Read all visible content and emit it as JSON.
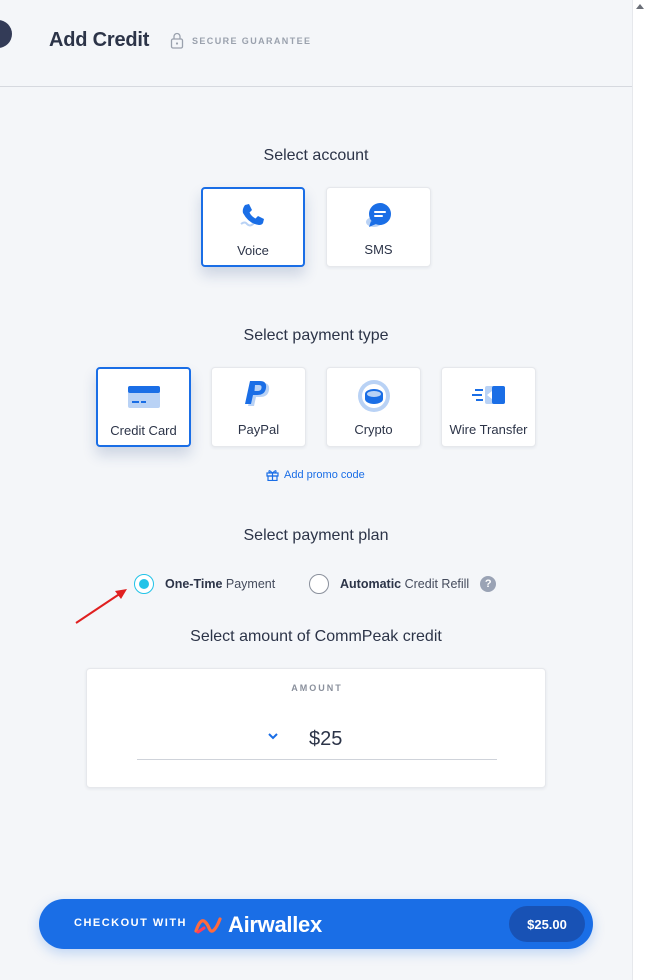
{
  "header": {
    "title": "Add Credit",
    "secure_label": "SECURE GUARANTEE"
  },
  "account": {
    "title": "Select account",
    "options": [
      {
        "label": "Voice",
        "icon": "phone-icon",
        "selected": true
      },
      {
        "label": "SMS",
        "icon": "chat-bubble-icon",
        "selected": false
      }
    ]
  },
  "payment_type": {
    "title": "Select payment type",
    "options": [
      {
        "label": "Credit Card",
        "icon": "credit-card-icon",
        "selected": true
      },
      {
        "label": "PayPal",
        "icon": "paypal-icon",
        "selected": false
      },
      {
        "label": "Crypto",
        "icon": "crypto-coin-icon",
        "selected": false
      },
      {
        "label": "Wire Transfer",
        "icon": "wire-transfer-icon",
        "selected": false
      }
    ],
    "promo_label": "Add promo code"
  },
  "payment_plan": {
    "title": "Select payment plan",
    "options": [
      {
        "bold": "One-Time",
        "rest": " Payment",
        "selected": true
      },
      {
        "bold": "Automatic",
        "rest": " Credit Refill",
        "selected": false
      }
    ],
    "help": "?"
  },
  "amount": {
    "title": "Select amount of CommPeak credit",
    "label": "AMOUNT",
    "value": "$25"
  },
  "checkout": {
    "prefix": "CHECKOUT WITH",
    "brand": "Airwallex",
    "price": "$25.00"
  },
  "colors": {
    "accent": "#1a6ee6",
    "radio_active": "#21c3e8",
    "background": "#f4f6f9",
    "text": "#2c3448",
    "annotation": "#e02020"
  }
}
